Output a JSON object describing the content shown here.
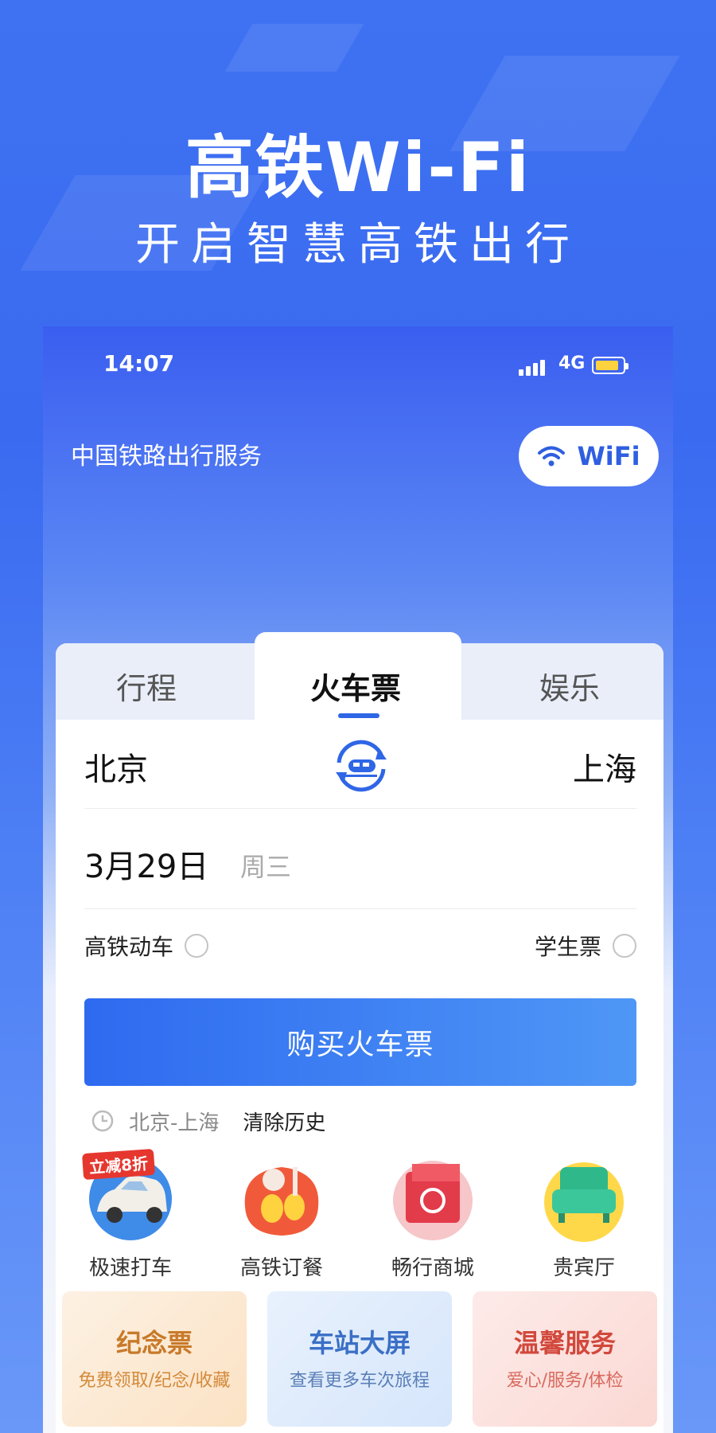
{
  "hero": {
    "title": "高铁Wi-Fi",
    "subtitle": "开启智慧高铁出行"
  },
  "status_bar": {
    "time": "14:07",
    "network": "4G"
  },
  "header": {
    "service_title": "中国铁路出行服务",
    "wifi_button_label": "WiFi"
  },
  "tabs": [
    {
      "label": "行程"
    },
    {
      "label": "火车票",
      "active": true
    },
    {
      "label": "娱乐"
    }
  ],
  "route": {
    "from": "北京",
    "to": "上海"
  },
  "date": {
    "value": "3月29日",
    "weekday": "周三"
  },
  "options": {
    "high_speed_label": "高铁动车",
    "student_label": "学生票"
  },
  "buy_button_label": "购买火车票",
  "history": {
    "item": "北京-上海",
    "clear_label": "清除历史"
  },
  "services": [
    {
      "label": "极速打车",
      "icon": "car-icon",
      "badge": "立减8折"
    },
    {
      "label": "高铁订餐",
      "icon": "meal-icon"
    },
    {
      "label": "畅行商城",
      "icon": "shop-icon"
    },
    {
      "label": "贵宾厅",
      "icon": "sofa-icon"
    }
  ],
  "tiles": [
    {
      "title": "纪念票",
      "desc": "免费领取/纪念/收藏"
    },
    {
      "title": "车站大屏",
      "desc": "查看更多车次旅程"
    },
    {
      "title": "温馨服务",
      "desc": "爱心/服务/体检"
    }
  ],
  "colors": {
    "primary": "#2f66e6",
    "hero_background": "#3f72f2",
    "battery": "#ffd23f",
    "promo": "#e6372f"
  }
}
